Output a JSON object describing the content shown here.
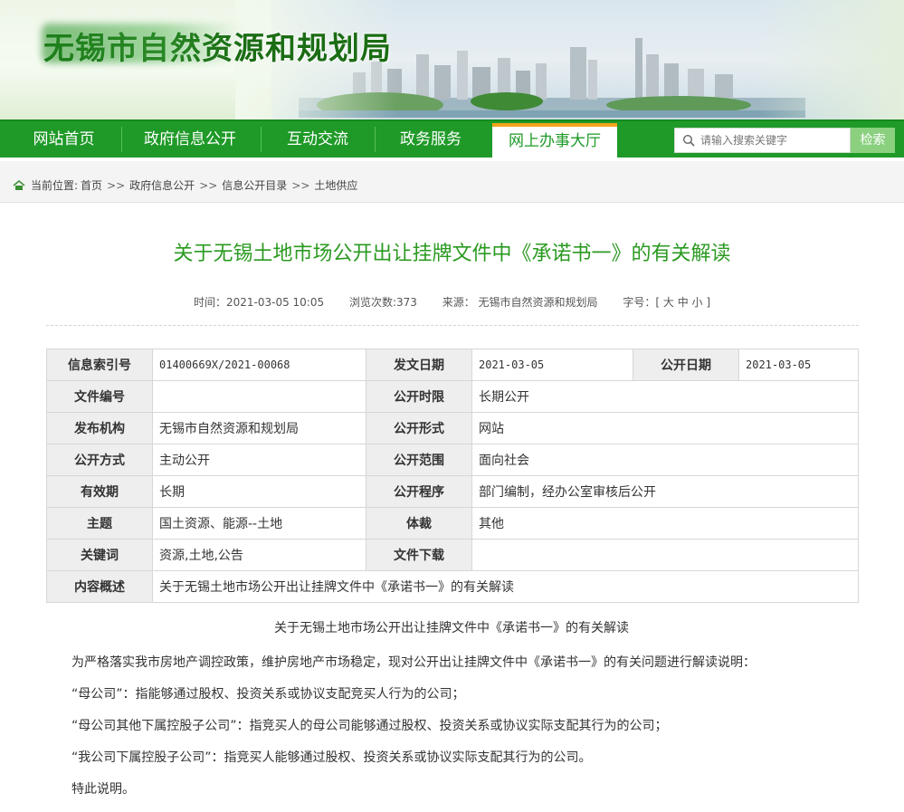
{
  "header": {
    "site_title": "无锡市自然资源和规划局"
  },
  "nav": {
    "items": [
      "网站首页",
      "政府信息公开",
      "互动交流",
      "政务服务",
      "网上办事大厅"
    ],
    "active_index": 4,
    "search_placeholder": "请输入搜索关键字",
    "search_button": "检索"
  },
  "breadcrumb": {
    "label": "当前位置:",
    "items": [
      "首页",
      "政府信息公开",
      "信息公开目录",
      "土地供应"
    ],
    "separator": ">>"
  },
  "article": {
    "title": "关于无锡土地市场公开出让挂牌文件中《承诺书一》的有关解读",
    "meta": {
      "time": "时间：2021-03-05 10:05",
      "views": "浏览次数:373",
      "source": "来源： 无锡市自然资源和规划局",
      "fontsize": "字号：[ 大 中 小 ]"
    }
  },
  "info_table": {
    "rows": [
      [
        "信息索引号",
        "01400669X/2021-00068",
        "发文日期",
        "2021-03-05",
        "公开日期",
        "2021-03-05"
      ],
      [
        "文件编号",
        "",
        "公开时限",
        "长期公开"
      ],
      [
        "发布机构",
        "无锡市自然资源和规划局",
        "公开形式",
        "网站"
      ],
      [
        "公开方式",
        "主动公开",
        "公开范围",
        "面向社会"
      ],
      [
        "有效期",
        "长期",
        "公开程序",
        "部门编制，经办公室审核后公开"
      ],
      [
        "主题",
        "国土资源、能源--土地",
        "体裁",
        "其他"
      ],
      [
        "关键词",
        "资源,土地,公告",
        "文件下载",
        ""
      ],
      [
        "内容概述",
        "关于无锡土地市场公开出让挂牌文件中《承诺书一》的有关解读"
      ]
    ]
  },
  "body": {
    "heading": "关于无锡土地市场公开出让挂牌文件中《承诺书一》的有关解读",
    "paragraphs": [
      "为严格落实我市房地产调控政策，维护房地产市场稳定，现对公开出让挂牌文件中《承诺书一》的有关问题进行解读说明：",
      "“母公司”：指能够通过股权、投资关系或协议支配竞买人行为的公司；",
      "“母公司其他下属控股子公司”：指竞买人的母公司能够通过股权、投资关系或协议实际支配其行为的公司；",
      "“我公司下属控股子公司”：指竞买人能够通过股权、投资关系或协议实际支配其行为的公司。",
      "特此说明。"
    ]
  },
  "colors": {
    "nav_green": "#1f9a28",
    "title_green": "#2a9a20",
    "accent_orange": "#f2a51a"
  }
}
